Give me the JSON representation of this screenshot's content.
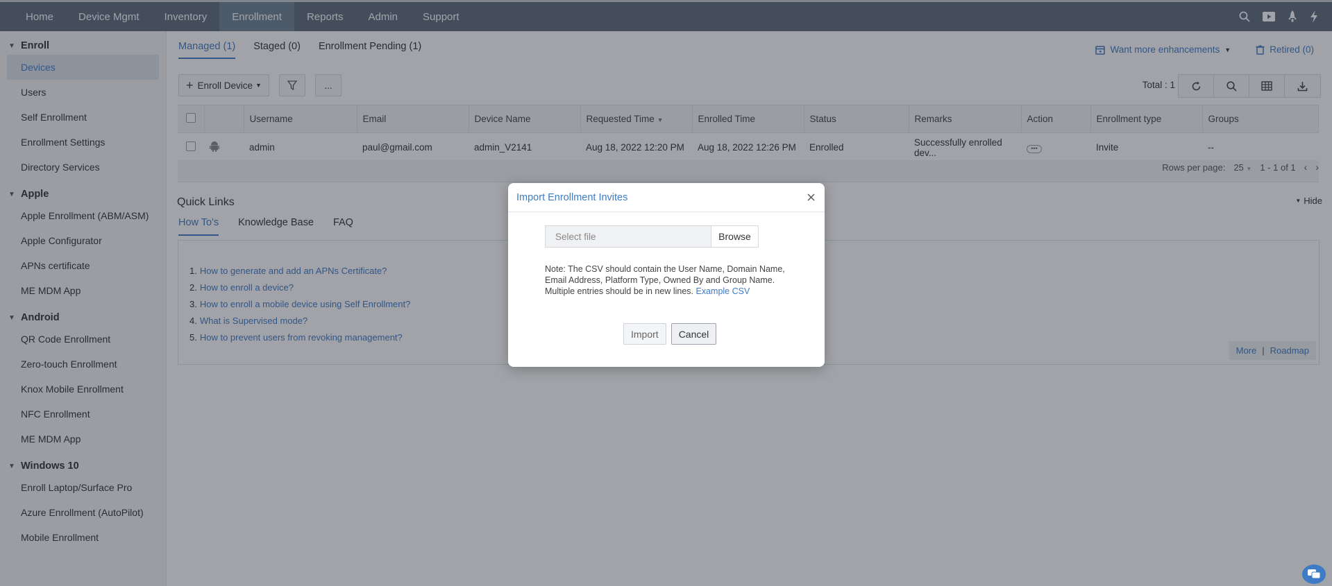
{
  "topnav": {
    "items": [
      "Home",
      "Device Mgmt",
      "Inventory",
      "Enrollment",
      "Reports",
      "Admin",
      "Support"
    ],
    "active": "Enrollment",
    "icons": [
      "search-icon",
      "video-icon",
      "rocket-icon",
      "lightning-icon"
    ]
  },
  "sidebar": {
    "sections": [
      {
        "title": "Enroll",
        "items": [
          "Devices",
          "Users",
          "Self Enrollment",
          "Enrollment Settings",
          "Directory Services"
        ]
      },
      {
        "title": "Apple",
        "items": [
          "Apple Enrollment (ABM/ASM)",
          "Apple Configurator",
          "APNs certificate",
          "ME MDM App"
        ]
      },
      {
        "title": "Android",
        "items": [
          "QR Code Enrollment",
          "Zero-touch Enrollment",
          "Knox Mobile Enrollment",
          "NFC Enrollment",
          "ME MDM App"
        ]
      },
      {
        "title": "Windows 10",
        "items": [
          "Enroll Laptop/Surface Pro",
          "Azure Enrollment (AutoPilot)",
          "Mobile Enrollment"
        ]
      }
    ],
    "active_item": "Devices"
  },
  "main": {
    "tabs": [
      "Managed (1)",
      "Staged (0)",
      "Enrollment Pending (1)"
    ],
    "active_tab": "Managed (1)",
    "links": {
      "enhancements": "Want more enhancements",
      "retired": "Retired (0)"
    },
    "toolbar": {
      "enroll_device": "Enroll Device",
      "more": "..."
    },
    "total": "Total : 1",
    "table": {
      "columns": [
        "Username",
        "Email",
        "Device Name",
        "Requested Time",
        "Enrolled Time",
        "Status",
        "Remarks",
        "Action",
        "Enrollment type",
        "Groups"
      ],
      "rows": [
        {
          "username": "admin",
          "email": "paul@gmail.com",
          "device_name": "admin_V2141",
          "requested": "Aug 18, 2022 12:20 PM",
          "enrolled": "Aug 18, 2022 12:26 PM",
          "status": "Enrolled",
          "remarks": "Successfully enrolled dev...",
          "enrollment_type": "Invite",
          "groups": "--"
        }
      ]
    },
    "pager": {
      "rows_label": "Rows per page:",
      "rows_value": "25",
      "range": "1 - 1 of 1"
    },
    "quick_links": {
      "title": "Quick Links",
      "hide": "Hide",
      "tabs": [
        "How To's",
        "Knowledge Base",
        "FAQ"
      ],
      "active_tab": "How To's",
      "items": [
        {
          "n": "1.",
          "q": "How to generate and add an APNs Certificate?"
        },
        {
          "n": "2.",
          "q": "How to enroll a device?"
        },
        {
          "n": "3.",
          "q": "How to enroll a mobile device using Self Enrollment?"
        },
        {
          "n": "4.",
          "q": "What is Supervised mode?"
        },
        {
          "n": "5.",
          "q": "How to prevent users from revoking management?"
        }
      ],
      "more": "More",
      "separator": "|",
      "roadmap": "Roadmap"
    }
  },
  "modal": {
    "title": "Import Enrollment Invites",
    "file_placeholder": "Select file",
    "browse": "Browse",
    "note": "Note: The CSV should contain the User Name, Domain Name, Email Address, Platform Type, Owned By and Group Name. Multiple entries should be in new lines.",
    "example_link": "Example CSV",
    "import": "Import",
    "cancel": "Cancel"
  },
  "colors": {
    "nav_bg": "#5d6c7d",
    "accent": "#3e7bc6",
    "success": "#2d9b4d"
  }
}
